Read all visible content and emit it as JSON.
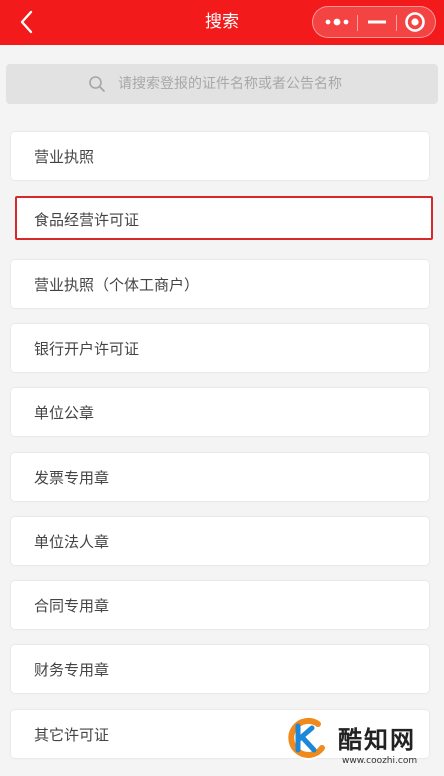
{
  "header": {
    "title": "搜索",
    "back_icon": "chevron-left-icon",
    "more_icon": "more-dots-icon",
    "minimize_icon": "minimize-icon",
    "close_icon": "target-close-icon",
    "background_color": "#f21a1a"
  },
  "search": {
    "placeholder": "请搜索登报的证件名称或者公告名称",
    "value": "",
    "icon": "search-icon"
  },
  "list": {
    "items": [
      {
        "label": "营业执照",
        "selected": false
      },
      {
        "label": "食品经营许可证",
        "selected": true
      },
      {
        "label": "营业执照（个体工商户）",
        "selected": false
      },
      {
        "label": "银行开户许可证",
        "selected": false
      },
      {
        "label": "单位公章",
        "selected": false
      },
      {
        "label": "发票专用章",
        "selected": false
      },
      {
        "label": "单位法人章",
        "selected": false
      },
      {
        "label": "合同专用章",
        "selected": false
      },
      {
        "label": "财务专用章",
        "selected": false
      },
      {
        "label": "其它许可证",
        "selected": false
      }
    ],
    "selected_border_color": "#d8282a"
  },
  "watermark": {
    "name": "酷知网",
    "url": "www.coozhi.com"
  }
}
